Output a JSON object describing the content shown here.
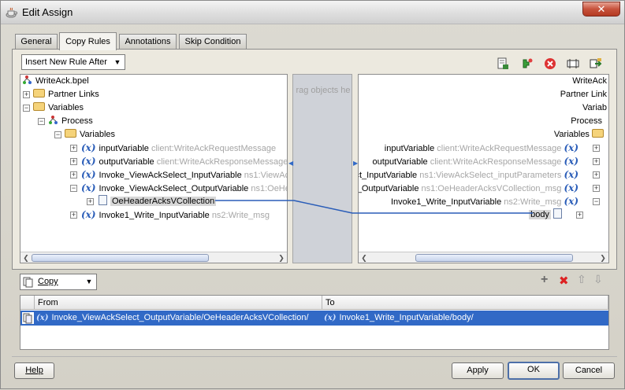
{
  "window": {
    "title": "Edit Assign",
    "close_glyph": "✕"
  },
  "tabs": [
    {
      "label": "General",
      "active": false
    },
    {
      "label": "Copy Rules",
      "active": true
    },
    {
      "label": "Annotations",
      "active": false
    },
    {
      "label": "Skip Condition",
      "active": false
    }
  ],
  "rule_combo": {
    "value": "Insert New Rule After"
  },
  "toolbar_icons": [
    "expression-icon",
    "xml-fragment-icon",
    "delete-icon",
    "xpath-icon",
    "swap-icon"
  ],
  "source_tree": {
    "root": "WriteAck.bpel",
    "partner_links": "Partner Links",
    "variables": "Variables",
    "process": "Process",
    "inner_variables": "Variables",
    "items": [
      {
        "name": "inputVariable",
        "type": "client:WriteAckRequestMessage"
      },
      {
        "name": "outputVariable",
        "type": "client:WriteAckResponseMessage"
      },
      {
        "name": "Invoke_ViewAckSelect_InputVariable",
        "type": "ns1:ViewAc"
      },
      {
        "name": "Invoke_ViewAckSelect_OutputVariable",
        "type": "ns1:OeHe"
      },
      {
        "name": "OeHeaderAcksVCollection",
        "type": ""
      },
      {
        "name": "Invoke1_Write_InputVariable",
        "type": "ns2:Write_msg"
      }
    ]
  },
  "middle_hint": "rag objects he",
  "target_tree": {
    "root": "WriteAck",
    "partner_links": "Partner Link",
    "variables": "Variab",
    "process": "Process",
    "inner_variables": "Variables",
    "items": [
      {
        "name": "inputVariable",
        "type": "client:WriteAckRequestMessage"
      },
      {
        "name": "outputVariable",
        "type": "client:WriteAckResponseMessage"
      },
      {
        "name": "elect_InputVariable",
        "type": "ns1:ViewAckSelect_inputParameters"
      },
      {
        "name": "elect_OutputVariable",
        "type": "ns1:OeHeaderAcksVCollection_msg"
      },
      {
        "name": "Invoke1_Write_InputVariable",
        "type": "ns2:Write_msg"
      },
      {
        "name": "body",
        "type": ""
      }
    ]
  },
  "copy_combo": {
    "value": "Copy"
  },
  "rules": {
    "columns": [
      "From",
      "To"
    ],
    "rows": [
      {
        "from": "Invoke_ViewAckSelect_OutputVariable/OeHeaderAcksVCollection/",
        "to": "Invoke1_Write_InputVariable/body/"
      }
    ]
  },
  "rule_actions": {
    "add": "+",
    "delete": "✖",
    "up": "⇧",
    "down": "⇩"
  },
  "buttons": {
    "help": "Help",
    "apply": "Apply",
    "ok": "OK",
    "cancel": "Cancel"
  },
  "colors": {
    "selection": "#3169c6",
    "mapping_line": "#2a5db8",
    "variable_icon": "#2a5db8"
  }
}
